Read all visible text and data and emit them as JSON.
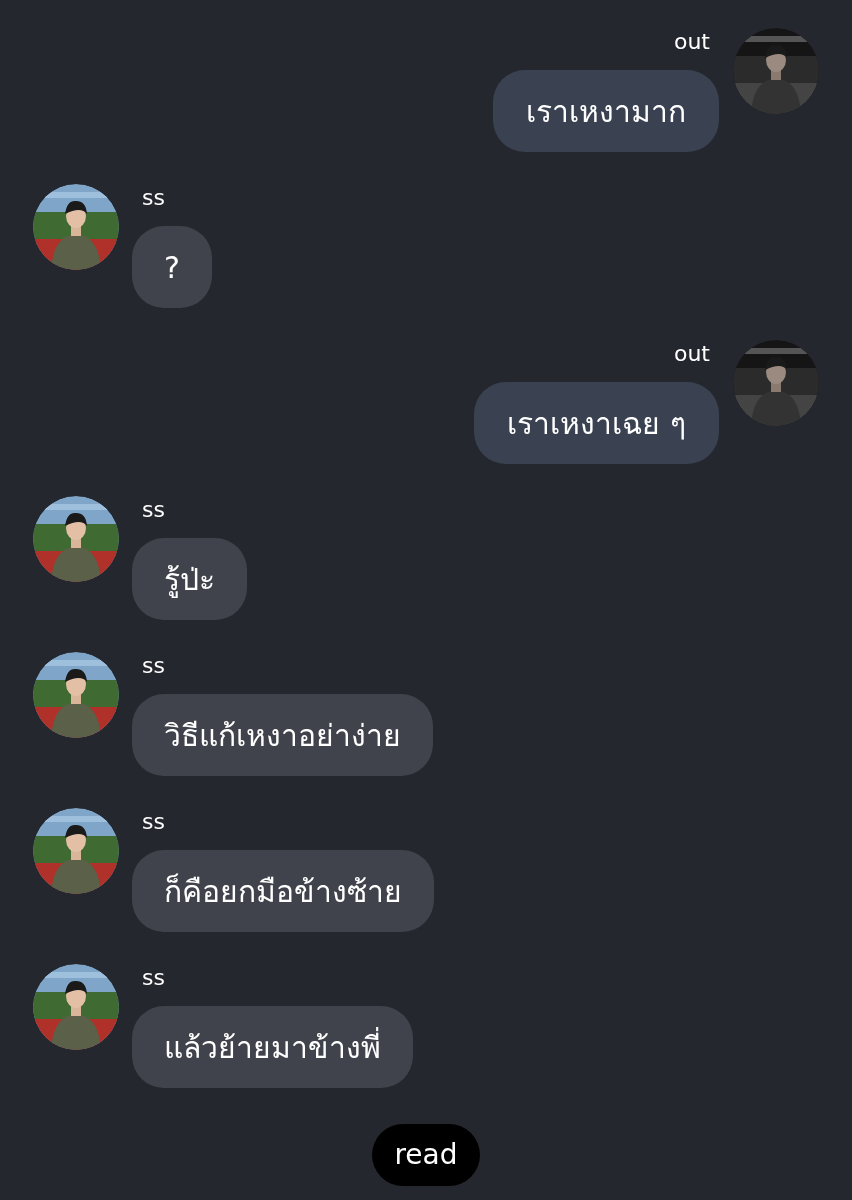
{
  "messages": [
    {
      "kind": "outgoing",
      "sender": "out",
      "text": "เราเหงามาก"
    },
    {
      "kind": "incoming",
      "sender": "ss",
      "text": "?"
    },
    {
      "kind": "outgoing",
      "sender": "out",
      "text": "เราเหงาเฉย ๆ"
    },
    {
      "kind": "incoming",
      "sender": "ss",
      "text": "รู้ป่ะ"
    },
    {
      "kind": "incoming",
      "sender": "ss",
      "text": "วิธีแก้เหงาอย่าง่าย"
    },
    {
      "kind": "incoming",
      "sender": "ss",
      "text": "ก็คือยกมือข้างซ้าย"
    },
    {
      "kind": "incoming",
      "sender": "ss",
      "text": "แล้วย้ายมาข้างพี่"
    }
  ],
  "status": "read"
}
